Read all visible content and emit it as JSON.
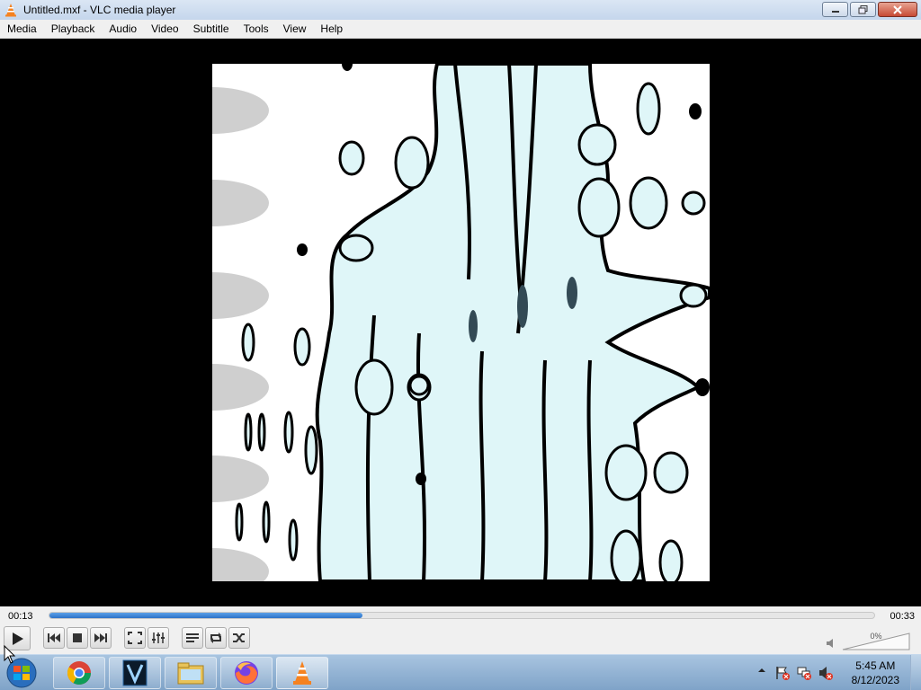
{
  "window": {
    "title": "Untitled.mxf - VLC media player",
    "icon": "vlc-cone-icon"
  },
  "menu": [
    "Media",
    "Playback",
    "Audio",
    "Video",
    "Subtitle",
    "Tools",
    "View",
    "Help"
  ],
  "player": {
    "elapsed": "00:13",
    "total": "00:33",
    "progress_percent": 38,
    "volume_label": "0%",
    "buttons": [
      "play-icon",
      "previous-icon",
      "stop-icon",
      "next-icon",
      "fullscreen-icon",
      "extended-settings-icon",
      "playlist-icon",
      "loop-icon",
      "shuffle-icon",
      "mute-icon"
    ]
  },
  "taskbar": {
    "apps": [
      "chrome-icon",
      "vegas-icon",
      "file-explorer-icon",
      "firefox-icon",
      "vlc-icon"
    ],
    "time": "5:45 AM",
    "date": "8/12/2023"
  },
  "colors": {
    "accent": "#3a82d8",
    "video_fill": "#dff6f8"
  }
}
